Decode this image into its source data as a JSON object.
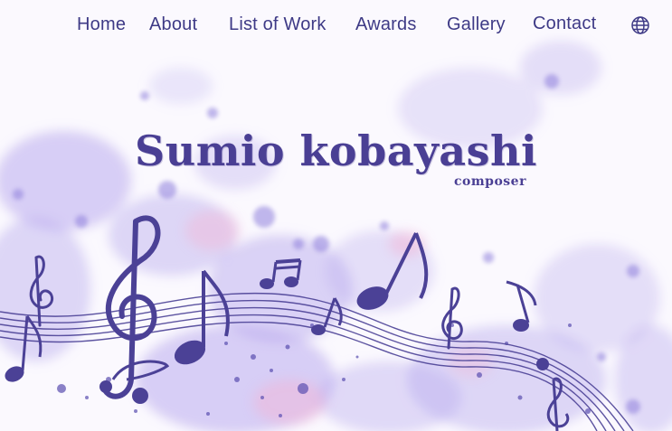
{
  "nav": {
    "items": [
      {
        "label": "Home"
      },
      {
        "label": "About"
      },
      {
        "label": "List of Work"
      },
      {
        "label": "Awards"
      },
      {
        "label": "Gallery"
      },
      {
        "label": "Contact"
      }
    ],
    "language_icon": "globe-icon"
  },
  "hero": {
    "title": "Sumio kobayashi",
    "subtitle": "composer"
  },
  "colors": {
    "accent": "#4a3f94",
    "nav_text": "#3e3a86",
    "background": "#fbf9fe",
    "splash": "#b6a9ea"
  }
}
